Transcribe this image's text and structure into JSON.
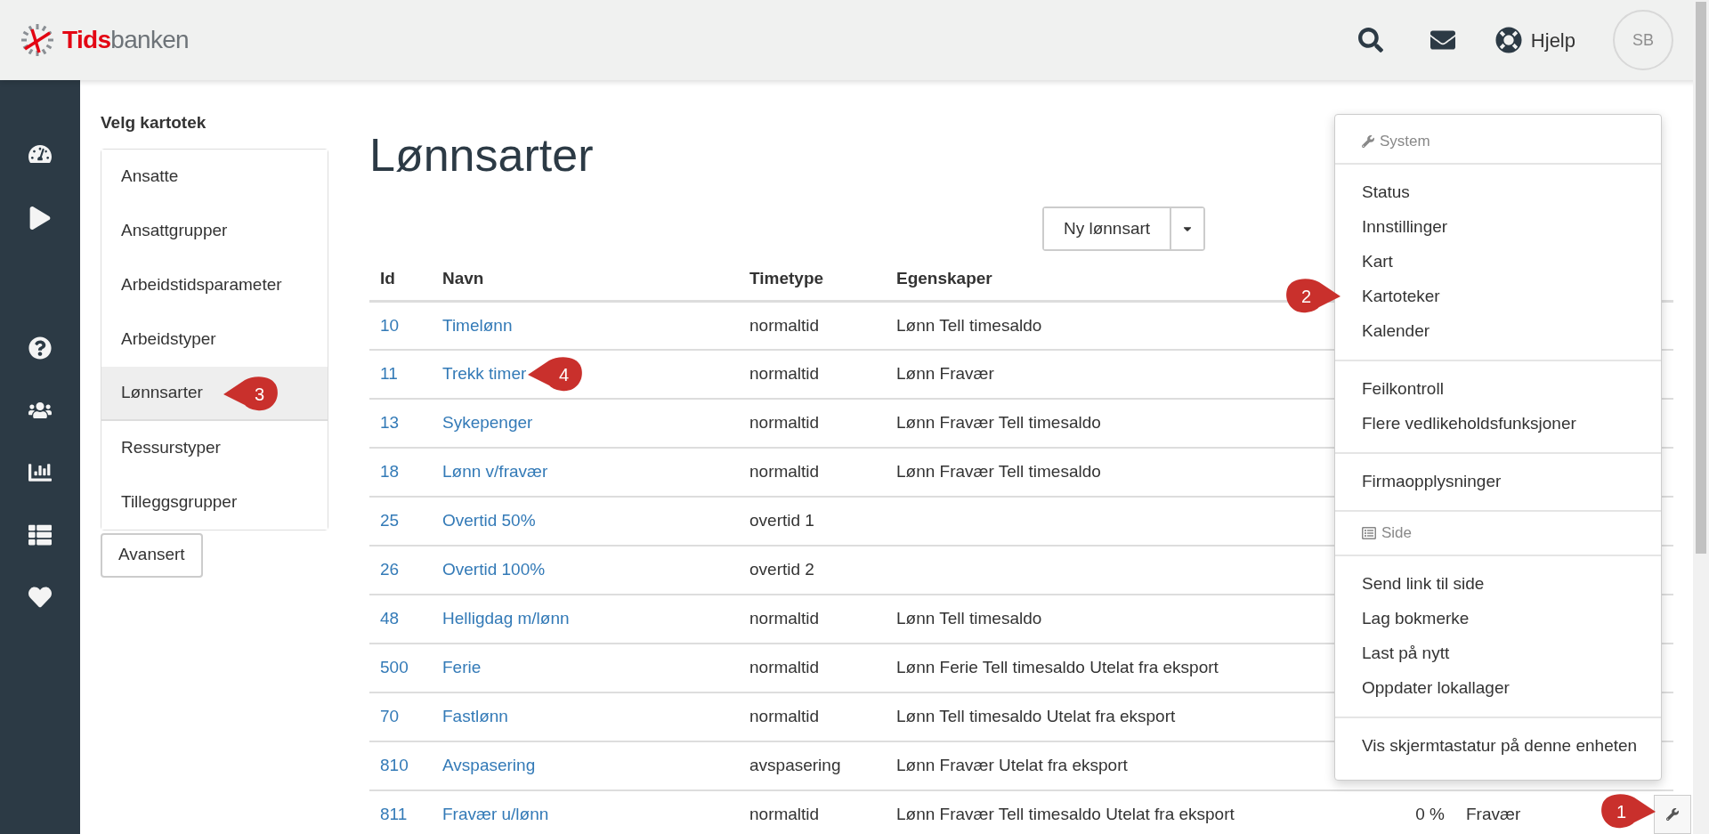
{
  "header": {
    "brand_first": "Tids",
    "brand_rest": "banken",
    "help_label": "Hjelp",
    "avatar_initials": "SB"
  },
  "kartotek": {
    "title": "Velg kartotek",
    "items": [
      {
        "label": "Ansatte",
        "selected": false
      },
      {
        "label": "Ansattgrupper",
        "selected": false
      },
      {
        "label": "Arbeidstidsparameter",
        "selected": false
      },
      {
        "label": "Arbeidstyper",
        "selected": false
      },
      {
        "label": "Lønnsarter",
        "selected": true,
        "callout": "3"
      },
      {
        "label": "Ressurstyper",
        "selected": false
      },
      {
        "label": "Tilleggsgrupper",
        "selected": false
      }
    ],
    "advanced_button": "Avansert"
  },
  "page_title": "Lønnsarter",
  "new_button": "Ny lønnsart",
  "table": {
    "columns": [
      "Id",
      "Navn",
      "Timetype",
      "Egenskaper"
    ],
    "rows": [
      {
        "id": "10",
        "name": "Timelønn",
        "timetype": "normaltid",
        "properties": "Lønn Tell timesaldo"
      },
      {
        "id": "11",
        "name": "Trekk timer",
        "timetype": "normaltid",
        "properties": "Lønn Fravær",
        "callout": "4"
      },
      {
        "id": "13",
        "name": "Sykepenger",
        "timetype": "normaltid",
        "properties": "Lønn Fravær Tell timesaldo"
      },
      {
        "id": "18",
        "name": "Lønn v/fravær",
        "timetype": "normaltid",
        "properties": "Lønn Fravær Tell timesaldo"
      },
      {
        "id": "25",
        "name": "Overtid 50%",
        "timetype": "overtid 1"
      },
      {
        "id": "26",
        "name": "Overtid 100%",
        "timetype": "overtid 2"
      },
      {
        "id": "48",
        "name": "Helligdag m/lønn",
        "timetype": "normaltid",
        "properties": "Lønn Tell timesaldo"
      },
      {
        "id": "500",
        "name": "Ferie",
        "timetype": "normaltid",
        "properties": "Lønn Ferie Tell timesaldo Utelat fra eksport"
      },
      {
        "id": "70",
        "name": "Fastlønn",
        "timetype": "normaltid",
        "properties": "Lønn Tell timesaldo Utelat fra eksport"
      },
      {
        "id": "810",
        "name": "Avspasering",
        "timetype": "avspasering",
        "properties": "Lønn Fravær Utelat fra eksport"
      },
      {
        "id": "811",
        "name": "Fravær u/lønn",
        "timetype": "normaltid",
        "properties": "Lønn Fravær Tell timesaldo Utelat fra eksport",
        "column_5": "0 %",
        "column_6": "Fravær"
      }
    ]
  },
  "menu": {
    "groups": [
      {
        "kind": "heading",
        "label": "System"
      },
      {
        "kind": "items",
        "items": [
          {
            "label": "Status"
          },
          {
            "label": "Innstillinger"
          },
          {
            "label": "Kart"
          },
          {
            "label": "Kartoteker",
            "callout": "2"
          },
          {
            "label": "Kalender"
          }
        ]
      },
      {
        "kind": "items",
        "items": [
          {
            "label": "Feilkontroll"
          },
          {
            "label": "Flere vedlikeholdsfunksjoner"
          }
        ]
      },
      {
        "kind": "items",
        "items": [
          {
            "label": "Firmaopplysninger"
          }
        ]
      },
      {
        "kind": "heading",
        "label": "Side"
      },
      {
        "kind": "items",
        "items": [
          {
            "label": "Send link til side"
          },
          {
            "label": "Lag bokmerke"
          },
          {
            "label": "Last på nytt"
          },
          {
            "label": "Oppdater lokallager"
          }
        ]
      },
      {
        "kind": "items",
        "items": [
          {
            "label": "Vis skjermtastatur på denne enheten"
          }
        ]
      }
    ]
  },
  "tools_button": {
    "callout": "1"
  }
}
